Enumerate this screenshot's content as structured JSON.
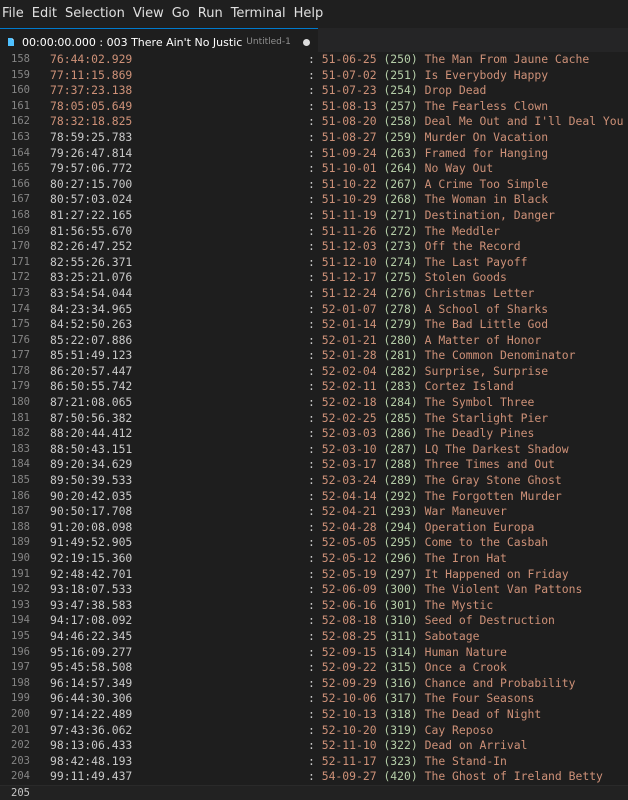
{
  "menubar": {
    "items": [
      "File",
      "Edit",
      "Selection",
      "View",
      "Go",
      "Run",
      "Terminal",
      "Help"
    ]
  },
  "tab": {
    "icon": "file-icon",
    "label": "00:00:00.000 : 003 There Ain't No Justic",
    "description": "Untitled-1",
    "modified_dot": true
  },
  "editor": {
    "lines": [
      {
        "n": "158",
        "ts": "76:44:02.929",
        "date": "51-06-25",
        "num": "(250)",
        "title": "The Man From Jaune Cache",
        "hl": true
      },
      {
        "n": "159",
        "ts": "77:11:15.869",
        "date": "51-07-02",
        "num": "(251)",
        "title": "Is Everybody Happy",
        "hl": true
      },
      {
        "n": "160",
        "ts": "77:37:23.138",
        "date": "51-07-23",
        "num": "(254)",
        "title": "Drop Dead",
        "hl": true
      },
      {
        "n": "161",
        "ts": "78:05:05.649",
        "date": "51-08-13",
        "num": "(257)",
        "title": "The Fearless Clown",
        "hl": true
      },
      {
        "n": "162",
        "ts": "78:32:18.825",
        "date": "51-08-20",
        "num": "(258)",
        "title": "Deal Me Out and I'll Deal You In",
        "hl": true
      },
      {
        "n": "163",
        "ts": "78:59:25.783",
        "date": "51-08-27",
        "num": "(259)",
        "title": "Murder On Vacation"
      },
      {
        "n": "164",
        "ts": "79:26:47.814",
        "date": "51-09-24",
        "num": "(263)",
        "title": "Framed for Hanging"
      },
      {
        "n": "165",
        "ts": "79:57:06.772",
        "date": "51-10-01",
        "num": "(264)",
        "title": "No Way Out"
      },
      {
        "n": "166",
        "ts": "80:27:15.700",
        "date": "51-10-22",
        "num": "(267)",
        "title": "A Crime Too Simple"
      },
      {
        "n": "167",
        "ts": "80:57:03.024",
        "date": "51-10-29",
        "num": "(268)",
        "title": "The Woman in Black"
      },
      {
        "n": "168",
        "ts": "81:27:22.165",
        "date": "51-11-19",
        "num": "(271)",
        "title": "Destination, Danger"
      },
      {
        "n": "169",
        "ts": "81:56:55.670",
        "date": "51-11-26",
        "num": "(272)",
        "title": "The Meddler"
      },
      {
        "n": "170",
        "ts": "82:26:47.252",
        "date": "51-12-03",
        "num": "(273)",
        "title": "Off the Record"
      },
      {
        "n": "171",
        "ts": "82:55:26.371",
        "date": "51-12-10",
        "num": "(274)",
        "title": "The Last Payoff"
      },
      {
        "n": "172",
        "ts": "83:25:21.076",
        "date": "51-12-17",
        "num": "(275)",
        "title": "Stolen Goods"
      },
      {
        "n": "173",
        "ts": "83:54:54.044",
        "date": "51-12-24",
        "num": "(276)",
        "title": "Christmas Letter"
      },
      {
        "n": "174",
        "ts": "84:23:34.965",
        "date": "52-01-07",
        "num": "(278)",
        "title": "A School of Sharks"
      },
      {
        "n": "175",
        "ts": "84:52:50.263",
        "date": "52-01-14",
        "num": "(279)",
        "title": "The Bad Little God"
      },
      {
        "n": "176",
        "ts": "85:22:07.886",
        "date": "52-01-21",
        "num": "(280)",
        "title": "A Matter of Honor"
      },
      {
        "n": "177",
        "ts": "85:51:49.123",
        "date": "52-01-28",
        "num": "(281)",
        "title": "The Common Denominator"
      },
      {
        "n": "178",
        "ts": "86:20:57.447",
        "date": "52-02-04",
        "num": "(282)",
        "title": "Surprise, Surprise"
      },
      {
        "n": "179",
        "ts": "86:50:55.742",
        "date": "52-02-11",
        "num": "(283)",
        "title": "Cortez Island"
      },
      {
        "n": "180",
        "ts": "87:21:08.065",
        "date": "52-02-18",
        "num": "(284)",
        "title": "The Symbol Three"
      },
      {
        "n": "181",
        "ts": "87:50:56.382",
        "date": "52-02-25",
        "num": "(285)",
        "title": "The Starlight Pier"
      },
      {
        "n": "182",
        "ts": "88:20:44.412",
        "date": "52-03-03",
        "num": "(286)",
        "title": "The Deadly Pines"
      },
      {
        "n": "183",
        "ts": "88:50:43.151",
        "date": "52-03-10",
        "num": "(287)",
        "title": "LQ The Darkest Shadow"
      },
      {
        "n": "184",
        "ts": "89:20:34.629",
        "date": "52-03-17",
        "num": "(288)",
        "title": "Three Times and Out"
      },
      {
        "n": "185",
        "ts": "89:50:39.533",
        "date": "52-03-24",
        "num": "(289)",
        "title": "The Gray Stone Ghost"
      },
      {
        "n": "186",
        "ts": "90:20:42.035",
        "date": "52-04-14",
        "num": "(292)",
        "title": "The Forgotten Murder"
      },
      {
        "n": "187",
        "ts": "90:50:17.708",
        "date": "52-04-21",
        "num": "(293)",
        "title": "War Maneuver"
      },
      {
        "n": "188",
        "ts": "91:20:08.098",
        "date": "52-04-28",
        "num": "(294)",
        "title": "Operation Europa"
      },
      {
        "n": "189",
        "ts": "91:49:52.905",
        "date": "52-05-05",
        "num": "(295)",
        "title": "Come to the Casbah"
      },
      {
        "n": "190",
        "ts": "92:19:15.360",
        "date": "52-05-12",
        "num": "(296)",
        "title": "The Iron Hat"
      },
      {
        "n": "191",
        "ts": "92:48:42.701",
        "date": "52-05-19",
        "num": "(297)",
        "title": "It Happened on Friday"
      },
      {
        "n": "192",
        "ts": "93:18:07.533",
        "date": "52-06-09",
        "num": "(300)",
        "title": "The Violent Van Pattons"
      },
      {
        "n": "193",
        "ts": "93:47:38.583",
        "date": "52-06-16",
        "num": "(301)",
        "title": "The Mystic"
      },
      {
        "n": "194",
        "ts": "94:17:08.092",
        "date": "52-08-18",
        "num": "(310)",
        "title": "Seed of Destruction"
      },
      {
        "n": "195",
        "ts": "94:46:22.345",
        "date": "52-08-25",
        "num": "(311)",
        "title": "Sabotage"
      },
      {
        "n": "196",
        "ts": "95:16:09.277",
        "date": "52-09-15",
        "num": "(314)",
        "title": "Human Nature"
      },
      {
        "n": "197",
        "ts": "95:45:58.508",
        "date": "52-09-22",
        "num": "(315)",
        "title": "Once a Crook"
      },
      {
        "n": "198",
        "ts": "96:14:57.349",
        "date": "52-09-29",
        "num": "(316)",
        "title": "Chance and Probability"
      },
      {
        "n": "199",
        "ts": "96:44:30.306",
        "date": "52-10-06",
        "num": "(317)",
        "title": "The Four Seasons"
      },
      {
        "n": "200",
        "ts": "97:14:22.489",
        "date": "52-10-13",
        "num": "(318)",
        "title": "The Dead of Night"
      },
      {
        "n": "201",
        "ts": "97:43:36.062",
        "date": "52-10-20",
        "num": "(319)",
        "title": "Cay Reposo"
      },
      {
        "n": "202",
        "ts": "98:13:06.433",
        "date": "52-11-10",
        "num": "(322)",
        "title": "Dead on Arrival"
      },
      {
        "n": "203",
        "ts": "98:42:48.193",
        "date": "52-11-17",
        "num": "(323)",
        "title": "The Stand-In"
      },
      {
        "n": "204",
        "ts": "99:11:49.437",
        "date": "54-09-27",
        "num": "(420)",
        "title": "The Ghost of Ireland Betty"
      },
      {
        "n": "205",
        "ts": "",
        "date": "",
        "num": "",
        "title": "",
        "current": true
      }
    ]
  }
}
